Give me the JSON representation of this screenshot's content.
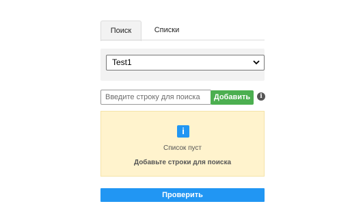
{
  "tabs": [
    {
      "label": "Поиск",
      "active": true
    },
    {
      "label": "Списки",
      "active": false
    }
  ],
  "list_select": {
    "selected": "Test1"
  },
  "search": {
    "placeholder": "Введите строку для поиска",
    "value": "",
    "add_label": "Добавить"
  },
  "empty_state": {
    "title": "Список пуст",
    "hint": "Добавьте строки для поиска"
  },
  "check_label": "Проверить",
  "colors": {
    "add_button": "#4caf50",
    "check_button": "#2196f3",
    "empty_panel": "#fff3cd",
    "info_badge": "#2196f3"
  },
  "icons": [
    "chevron-down-icon",
    "info-icon",
    "info-badge-icon"
  ]
}
